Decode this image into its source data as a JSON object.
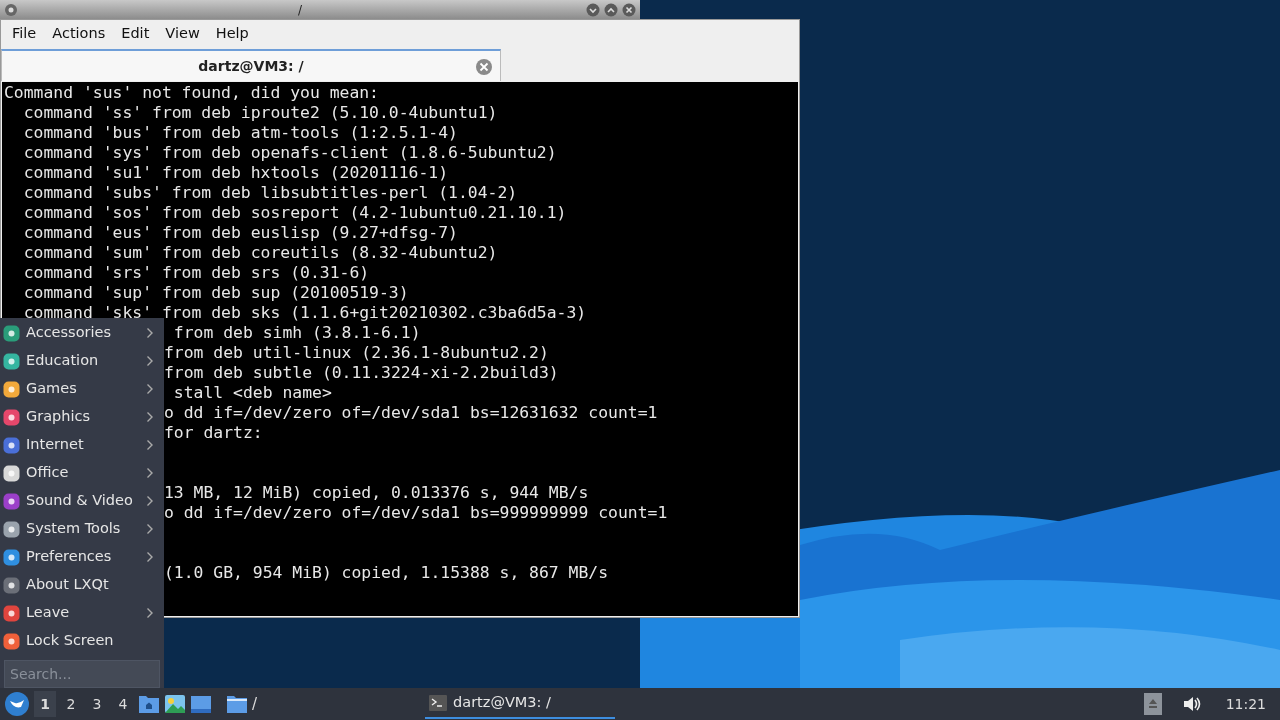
{
  "window": {
    "title": "/"
  },
  "menubar": [
    "File",
    "Actions",
    "Edit",
    "View",
    "Help"
  ],
  "tabs": [
    {
      "label": "dartz@VM3: /",
      "selected": true
    }
  ],
  "terminal": [
    {
      "kind": "full",
      "text": "Command 'sus' not found, did you mean:"
    },
    {
      "kind": "full",
      "text": "  command 'ss' from deb iproute2 (5.10.0-4ubuntu1)"
    },
    {
      "kind": "full",
      "text": "  command 'bus' from deb atm-tools (1:2.5.1-4)"
    },
    {
      "kind": "full",
      "text": "  command 'sys' from deb openafs-client (1.8.6-5ubuntu2)"
    },
    {
      "kind": "full",
      "text": "  command 'su1' from deb hxtools (20201116-1)"
    },
    {
      "kind": "full",
      "text": "  command 'subs' from deb libsubtitles-perl (1.04-2)"
    },
    {
      "kind": "full",
      "text": "  command 'sos' from deb sosreport (4.2-1ubuntu0.21.10.1)"
    },
    {
      "kind": "full",
      "text": "  command 'eus' from deb euslisp (9.27+dfsg-7)"
    },
    {
      "kind": "full",
      "text": "  command 'sum' from deb coreutils (8.32-4ubuntu2)"
    },
    {
      "kind": "full",
      "text": "  command 'srs' from deb srs (0.31-6)"
    },
    {
      "kind": "full",
      "text": "  command 'sup' from deb sup (20100519-3)"
    },
    {
      "kind": "full",
      "text": "  command 'sks' from deb sks (1.1.6+git20210302.c3ba6d5a-3)"
    },
    {
      "kind": "partial",
      "text": " from deb simh (3.8.1-6.1)"
    },
    {
      "kind": "partial",
      "text": "from deb util-linux (2.36.1-8ubuntu2.2)"
    },
    {
      "kind": "partial",
      "text": "from deb subtle (0.11.3224-xi-2.2build3)"
    },
    {
      "kind": "partial",
      "text": " stall <deb name>"
    },
    {
      "kind": "partial",
      "text": "o dd if=/dev/zero of=/dev/sda1 bs=12631632 count=1"
    },
    {
      "kind": "partial",
      "text": "for dartz:"
    },
    {
      "kind": "blank"
    },
    {
      "kind": "blank"
    },
    {
      "kind": "partial",
      "text": "13 MB, 12 MiB) copied, 0.013376 s, 944 MB/s"
    },
    {
      "kind": "partial",
      "text": "o dd if=/dev/zero of=/dev/sda1 bs=999999999 count=1"
    },
    {
      "kind": "blank"
    },
    {
      "kind": "blank"
    },
    {
      "kind": "partial",
      "text": "(1.0 GB, 954 MiB) copied, 1.15388 s, 867 MB/s"
    }
  ],
  "app_menu": {
    "items": [
      {
        "label": "Accessories",
        "color": "#2a9d7a",
        "submenu": true
      },
      {
        "label": "Education",
        "color": "#35b5a0",
        "submenu": true
      },
      {
        "label": "Games",
        "color": "#f2a93b",
        "submenu": true
      },
      {
        "label": "Graphics",
        "color": "#e5476b",
        "submenu": true
      },
      {
        "label": "Internet",
        "color": "#4a6fd8",
        "submenu": true
      },
      {
        "label": "Office",
        "color": "#d8d8d8",
        "submenu": true
      },
      {
        "label": "Sound & Video",
        "color": "#9b3fc9",
        "submenu": true
      },
      {
        "label": "System Tools",
        "color": "#9aa3ad",
        "submenu": true
      },
      {
        "label": "Preferences",
        "color": "#2f8fe0",
        "submenu": true
      },
      {
        "label": "About LXQt",
        "color": "#6b6f78",
        "submenu": false
      },
      {
        "label": "Leave",
        "color": "#e0453e",
        "submenu": true
      },
      {
        "label": "Lock Screen",
        "color": "#f0603a",
        "submenu": false
      }
    ],
    "search": {
      "placeholder": "Search..."
    }
  },
  "taskbar": {
    "desktops": [
      {
        "label": "1",
        "selected": true
      },
      {
        "label": "2",
        "selected": false
      },
      {
        "label": "3",
        "selected": false
      },
      {
        "label": "4",
        "selected": false
      }
    ],
    "folder_task": "/",
    "tasks": [
      {
        "label": "dartz@VM3: /",
        "selected": true
      }
    ],
    "clock": "11:21"
  }
}
